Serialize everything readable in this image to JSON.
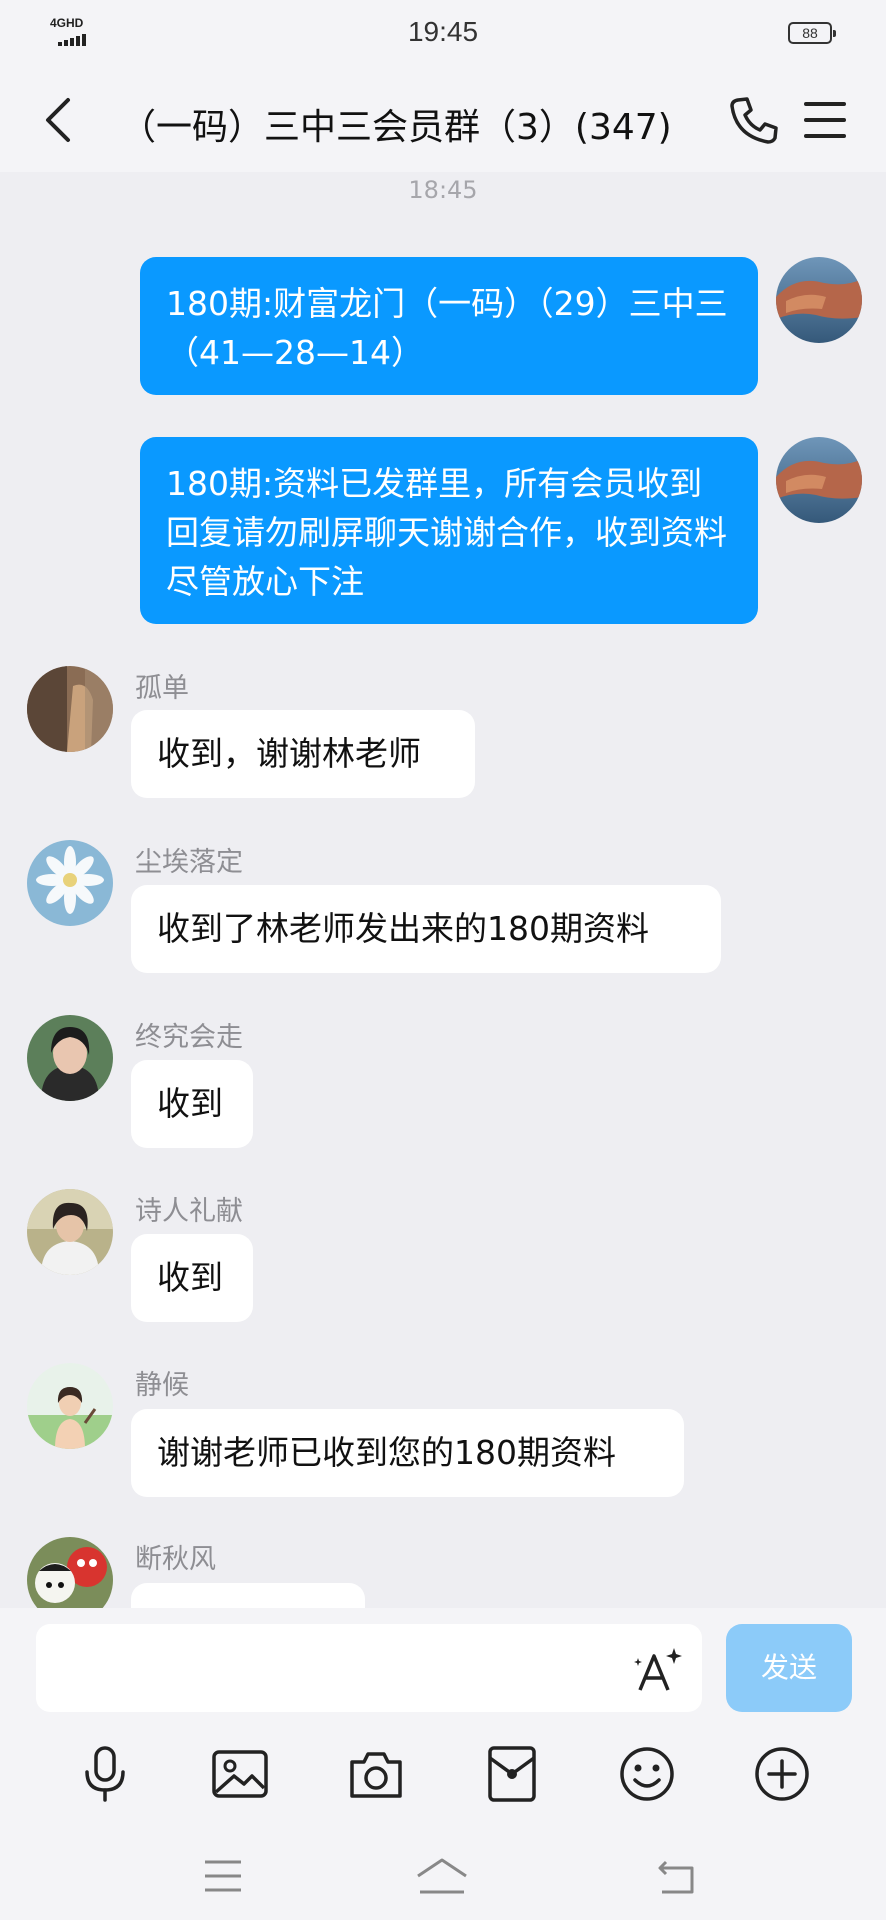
{
  "status_bar": {
    "network": "4GHD",
    "time": "19:45",
    "battery": "88"
  },
  "header": {
    "title": "（一码）三中三会员群（3）(347)"
  },
  "timestamp": "18:45",
  "outgoing": [
    {
      "text": "180期:财富龙门（一码）（29）三中三（41—28—14）"
    },
    {
      "text": "180期:资料已发群里，所有会员收到回复请勿刷屏聊天谢谢合作，收到资料尽管放心下注"
    }
  ],
  "incoming": [
    {
      "sender": "孤单",
      "text": "收到，谢谢林老师"
    },
    {
      "sender": "尘埃落定",
      "text": "收到了林老师发出来的180期资料"
    },
    {
      "sender": "终究会走",
      "text": "收到"
    },
    {
      "sender": "诗人礼献",
      "text": "收到"
    },
    {
      "sender": "静候",
      "text": "谢谢老师已收到您的180期资料"
    },
    {
      "sender": "断秋风",
      "text": ""
    }
  ],
  "composer": {
    "value": "",
    "placeholder": "",
    "send_label": "发送"
  },
  "toolbar_icons": [
    "microphone-icon",
    "image-icon",
    "camera-icon",
    "red-packet-icon",
    "emoji-icon",
    "plus-circle-icon"
  ],
  "colors": {
    "accent": "#0a99ff",
    "send_disabled": "#8ccbf9",
    "background": "#eeeef2"
  }
}
